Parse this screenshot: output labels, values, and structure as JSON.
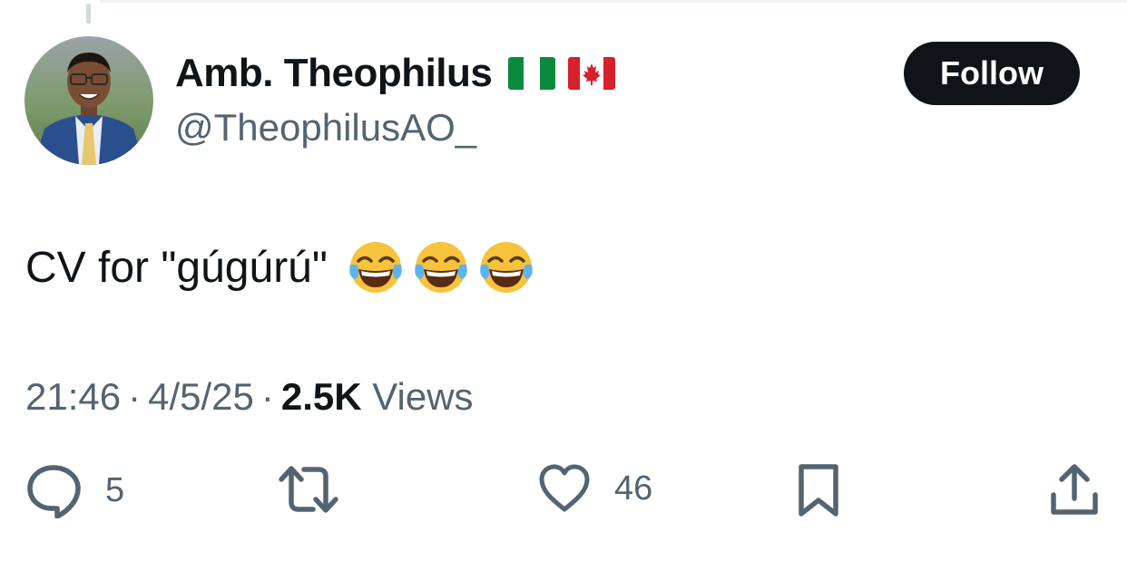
{
  "author": {
    "display_name": "Amb. Theophilus",
    "handle": "@TheophilusAO_",
    "flags": [
      "nigeria-flag",
      "canada-flag"
    ]
  },
  "follow_label": "Follow",
  "tweet": {
    "text": "CV for \"gúgúrú\"",
    "emojis": [
      "face-with-tears-of-joy",
      "face-with-tears-of-joy",
      "face-with-tears-of-joy"
    ]
  },
  "meta": {
    "time": "21:46",
    "separator": "·",
    "date": "4/5/25",
    "views_count": "2.5K",
    "views_label": "Views"
  },
  "actions": {
    "reply_count": "5",
    "like_count": "46"
  },
  "colors": {
    "text": "#0f1419",
    "secondary": "#536471",
    "button_bg": "#0f1419",
    "icon": "#536471"
  }
}
